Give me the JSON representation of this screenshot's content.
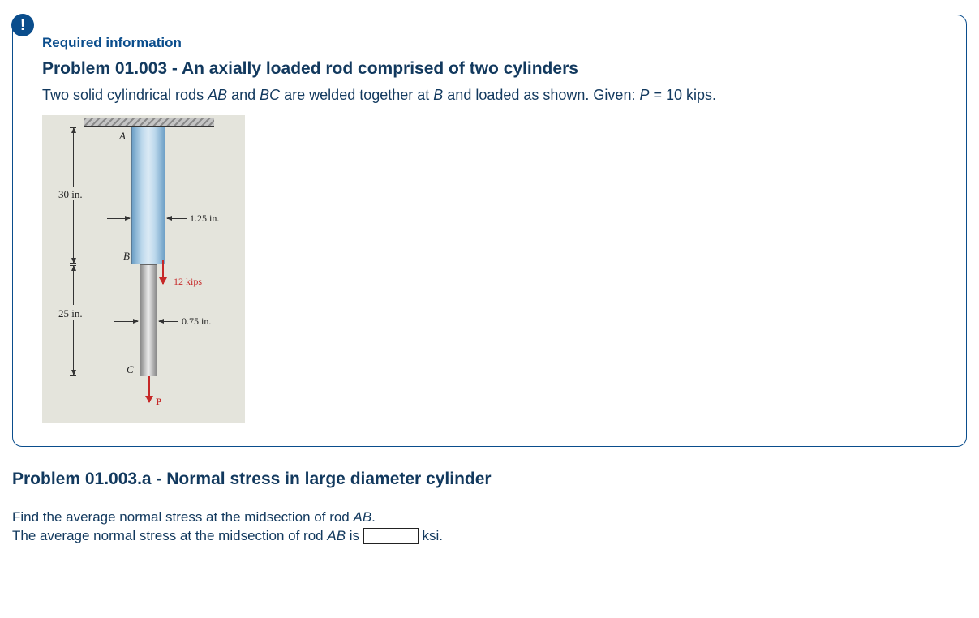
{
  "info_label": "Required information",
  "problem_title": "Problem 01.003 - An axially loaded rod comprised of two cylinders",
  "problem_desc_pre": "Two solid cylindrical rods ",
  "ab": "AB",
  "and_txt": " and ",
  "bc": "BC",
  "problem_desc_mid": " are welded together at ",
  "b_only": "B",
  "problem_desc_post": " and loaded as shown. Given: ",
  "p_var": "P",
  "p_eq": " = 10 kips.",
  "sub_title": "Problem 01.003.a - Normal stress in large diameter cylinder",
  "q_line1_pre": "Find the average normal stress at the midsection of  rod ",
  "q_line1_post": ".",
  "q_line2_pre": "The average normal stress at the midsection of  rod ",
  "q_line2_post": " is ",
  "unit": " ksi.",
  "answer_value": "",
  "fig": {
    "A": "A",
    "B": "B",
    "C": "C",
    "len_ab": "30 in.",
    "len_bc": "25 in.",
    "dia_ab": "1.25 in.",
    "dia_bc": "0.75 in.",
    "load_b": "12 kips",
    "load_p": "P"
  }
}
